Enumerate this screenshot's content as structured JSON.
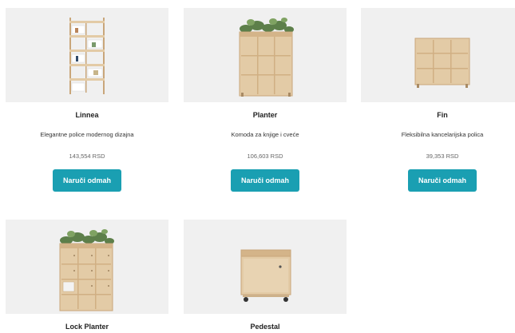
{
  "products": [
    {
      "name": "Linnea",
      "description": "Elegantne police modernog dizajna",
      "price": "143,554 RSD",
      "button_label": "Naruči odmah",
      "image_icon": "bookshelf-icon"
    },
    {
      "name": "Planter",
      "description": "Komoda za knjige i cveće",
      "price": "106,603 RSD",
      "button_label": "Naruči odmah",
      "image_icon": "planter-shelf-icon"
    },
    {
      "name": "Fin",
      "description": "Fleksibilna kancelarijska polica",
      "price": "39,353 RSD",
      "button_label": "Naruči odmah",
      "image_icon": "cube-shelf-icon"
    },
    {
      "name": "Lock Planter",
      "image_icon": "locker-planter-icon"
    },
    {
      "name": "Pedestal",
      "image_icon": "pedestal-cabinet-icon"
    }
  ],
  "colors": {
    "button": "#1a9fb2",
    "image_bg": "#f0f0f0",
    "wood": "#d9bf9a"
  }
}
